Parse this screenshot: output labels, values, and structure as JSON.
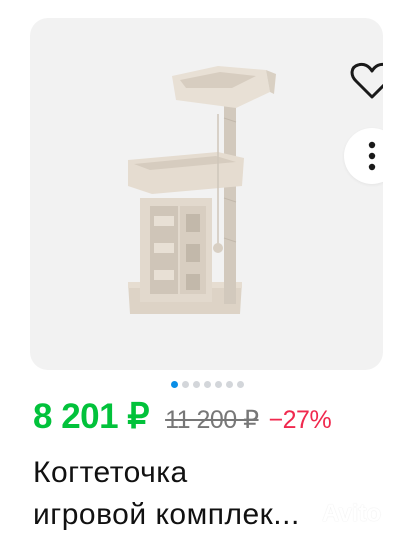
{
  "listing": {
    "price": "8 201 ₽",
    "old_price": "11 200 ₽",
    "discount": "−27%",
    "title_line1": "Когтеточка",
    "title_line2": "игровой комплек..."
  },
  "gallery": {
    "total_images": 7,
    "current_index": 1
  },
  "watermark": "Avito",
  "icons": [
    "heart-outline-icon",
    "more-vertical-icon"
  ],
  "colors": {
    "price": "#02c23b",
    "discount": "#f0294e",
    "active_dot": "#0a8ee6"
  }
}
